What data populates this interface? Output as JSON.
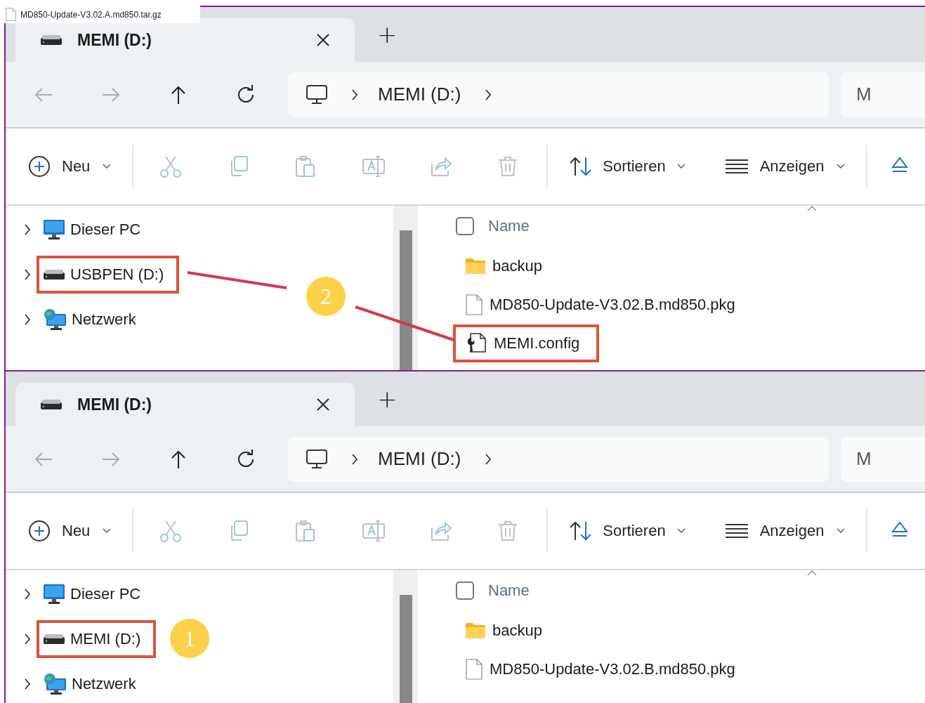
{
  "file_label": {
    "text": "MD850-Update-V3.02.A.md850.tar.gz"
  },
  "windows": [
    {
      "tab": {
        "title": "MEMI (D:)"
      },
      "new_tab": "+",
      "nav_buttons": [
        {
          "kind": "back",
          "disabled": true
        },
        {
          "kind": "forward",
          "disabled": true
        },
        {
          "kind": "up",
          "disabled": false
        },
        {
          "kind": "refresh",
          "disabled": false
        }
      ],
      "address": {
        "segments": [
          "MEMI (D:)"
        ]
      },
      "search": {
        "placeholder": "M"
      },
      "toolbar": {
        "new": "Neu",
        "actions": [
          {
            "kind": "cut",
            "disabled": true
          },
          {
            "kind": "copy",
            "disabled": true
          },
          {
            "kind": "paste",
            "disabled": true
          },
          {
            "kind": "rename",
            "disabled": true
          },
          {
            "kind": "share",
            "disabled": true
          },
          {
            "kind": "delete",
            "disabled": true
          }
        ],
        "sort": "Sortieren",
        "view": "Anzeigen"
      },
      "sidebar": [
        {
          "label": "Dieser PC",
          "kind": "pc",
          "highlighted": false
        },
        {
          "label": "USBPEN (D:)",
          "kind": "drive",
          "highlighted": true
        },
        {
          "label": "Netzwerk",
          "kind": "network",
          "highlighted": false
        }
      ],
      "files": {
        "column": "Name",
        "checked": false,
        "rows": [
          {
            "name": "backup",
            "kind": "folder",
            "highlighted": false
          },
          {
            "name": "MD850-Update-V3.02.B.md850.pkg",
            "kind": "file",
            "highlighted": false
          },
          {
            "name": "MEMI.config",
            "kind": "config",
            "highlighted": true
          }
        ]
      },
      "callout": {
        "label": "2",
        "kind": "linked"
      }
    },
    {
      "tab": {
        "title": "MEMI (D:)"
      },
      "new_tab": "+",
      "nav_buttons": [
        {
          "kind": "back",
          "disabled": true
        },
        {
          "kind": "forward",
          "disabled": true
        },
        {
          "kind": "up",
          "disabled": false
        },
        {
          "kind": "refresh",
          "disabled": false
        }
      ],
      "address": {
        "segments": [
          "MEMI (D:)"
        ]
      },
      "search": {
        "placeholder": "M"
      },
      "toolbar": {
        "new": "Neu",
        "actions": [
          {
            "kind": "cut",
            "disabled": true
          },
          {
            "kind": "copy",
            "disabled": true
          },
          {
            "kind": "paste",
            "disabled": true
          },
          {
            "kind": "rename",
            "disabled": true
          },
          {
            "kind": "share",
            "disabled": true
          },
          {
            "kind": "delete",
            "disabled": true
          }
        ],
        "sort": "Sortieren",
        "view": "Anzeigen"
      },
      "sidebar": [
        {
          "label": "Dieser PC",
          "kind": "pc",
          "highlighted": false
        },
        {
          "label": "MEMI (D:)",
          "kind": "drive",
          "highlighted": true
        },
        {
          "label": "Netzwerk",
          "kind": "network",
          "highlighted": false
        }
      ],
      "files": {
        "column": "Name",
        "checked": false,
        "rows": [
          {
            "name": "backup",
            "kind": "folder",
            "highlighted": false
          },
          {
            "name": "MD850-Update-V3.02.B.md850.pkg",
            "kind": "file",
            "highlighted": false
          }
        ]
      },
      "callout": {
        "label": "1",
        "kind": "beside"
      }
    }
  ]
}
